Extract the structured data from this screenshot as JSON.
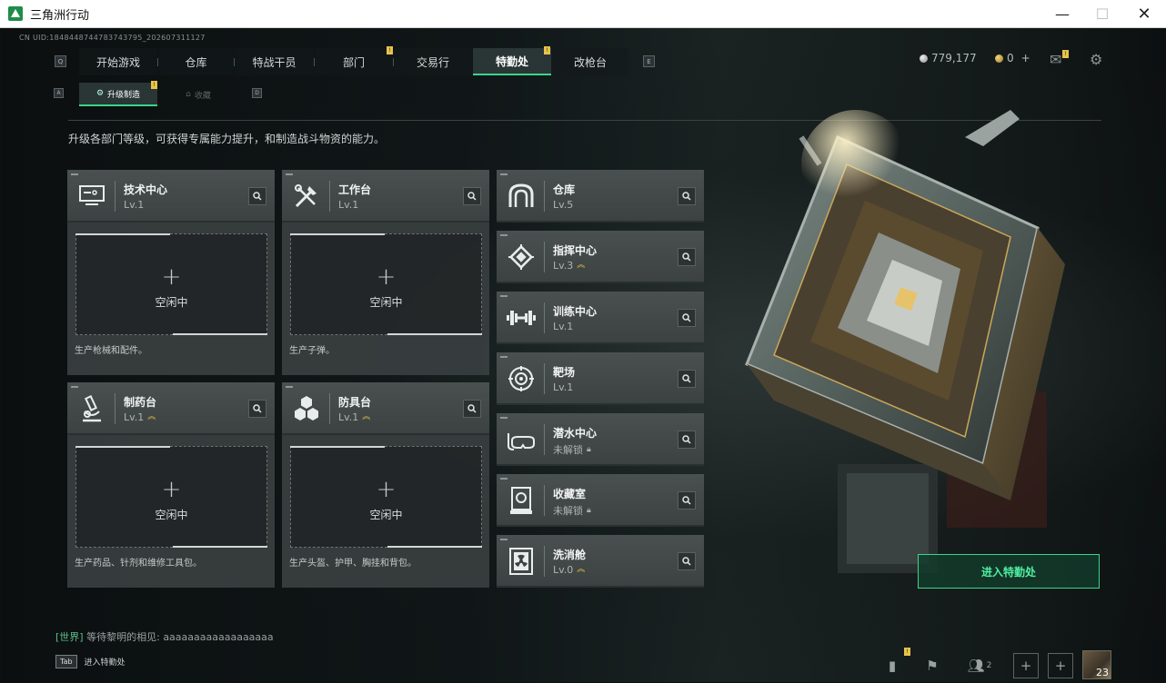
{
  "window": {
    "title": "三角洲行动",
    "min": "—",
    "max": "☐",
    "close": "✕"
  },
  "uid": "CN UID:1848448744783743795_202607311127",
  "topnav": {
    "key_left": "Q",
    "key_right": "E",
    "tabs": [
      {
        "label": "开始游戏"
      },
      {
        "label": "仓库"
      },
      {
        "label": "特战干员"
      },
      {
        "label": "部门"
      },
      {
        "label": "交易行"
      },
      {
        "label": "特勤处"
      },
      {
        "label": "改枪台"
      }
    ],
    "active_tab": "特勤处"
  },
  "subnav": {
    "key_left": "A",
    "key_right": "D",
    "tabs": [
      {
        "label": "升级制造",
        "active": true
      },
      {
        "label": "收藏",
        "active": false
      }
    ]
  },
  "description": "升级各部门等级，可获得专属能力提升，和制造战斗物资的能力。",
  "resources": {
    "coins": "779,177",
    "tickets": "0",
    "plus": "+"
  },
  "workshops": [
    {
      "name": "技术中心",
      "level": "Lv.1",
      "icon": "computer-icon",
      "slot_status": "空闲中",
      "slot_plus": "+",
      "footer": "生产枪械和配件。"
    },
    {
      "name": "工作台",
      "level": "Lv.1",
      "icon": "tools-icon",
      "slot_status": "空闲中",
      "slot_plus": "+",
      "footer": "生产子弹。"
    },
    {
      "name": "制药台",
      "level": "Lv.1",
      "icon": "microscope-icon",
      "slot_status": "空闲中",
      "slot_plus": "+",
      "footer": "生产药品、针剂和维修工具包。"
    },
    {
      "name": "防具台",
      "level": "Lv.1",
      "icon": "hexagons-icon",
      "slot_status": "空闲中",
      "slot_plus": "+",
      "footer": "生产头盔、护甲、胸挂和背包。"
    }
  ],
  "facilities": [
    {
      "name": "仓库",
      "level": "Lv.5",
      "icon": "vault-icon"
    },
    {
      "name": "指挥中心",
      "level": "Lv.3",
      "icon": "chip-icon"
    },
    {
      "name": "训练中心",
      "level": "Lv.1",
      "icon": "dumbbell-icon"
    },
    {
      "name": "靶场",
      "level": "Lv.1",
      "icon": "target-icon"
    },
    {
      "name": "潜水中心",
      "level": "未解锁",
      "icon": "diving-mask-icon"
    },
    {
      "name": "收藏室",
      "level": "未解锁",
      "icon": "collection-icon"
    },
    {
      "name": "洗消舱",
      "level": "Lv.0",
      "icon": "radiation-icon"
    }
  ],
  "enter_button": "进入特勤处",
  "chat": {
    "channel": "[世界]",
    "sender": "等待黎明的相见:",
    "message": "aaaaaaaaaaaaaaaaaa"
  },
  "tab_hint": {
    "key": "Tab",
    "label": "进入特勤处"
  },
  "bottom": {
    "friends_count": "2",
    "player_level": "23"
  },
  "colors": {
    "accent": "#39d68a",
    "notice": "#e8c34a"
  }
}
